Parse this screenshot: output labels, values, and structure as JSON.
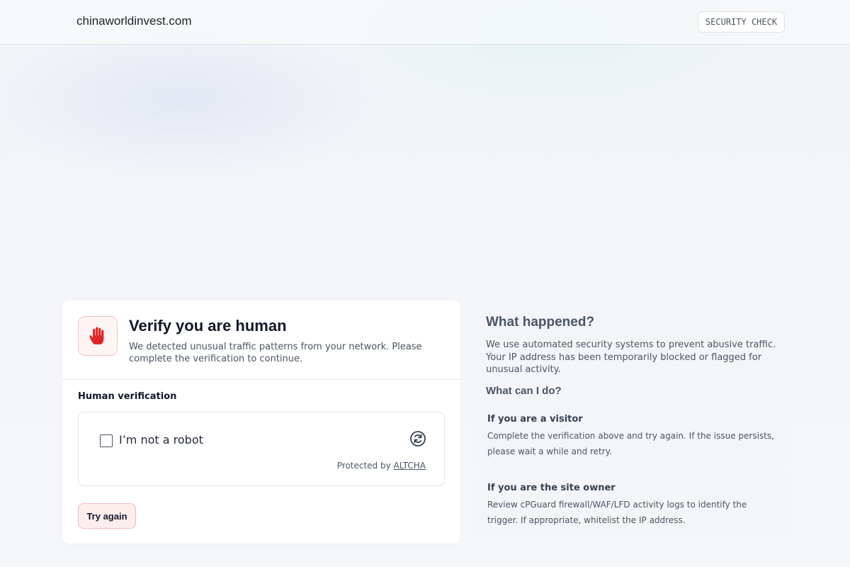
{
  "header": {
    "domain": "chinaworldinvest.com",
    "badge": "SECURITY CHECK"
  },
  "card": {
    "icon": "stop-hand-icon",
    "title": "Verify you are human",
    "subtitle": "We detected unusual traffic patterns from your network. Please complete the verification to continue.",
    "section_label": "Human verification",
    "widget": {
      "checkbox_label": "I’m not a robot",
      "checked": false,
      "refresh_icon": "refresh-icon",
      "protected_prefix": "Protected by",
      "protected_link": "ALTCHA"
    },
    "try_again_label": "Try again"
  },
  "info": {
    "heading": "What happened?",
    "description": "We use automated security systems to prevent abusive traffic. Your IP address has been temporarily blocked or flagged for unusual activity.",
    "subheading": "What can I do?",
    "panels": [
      {
        "title": "If you are a visitor",
        "text": "Complete the verification above and try again. If the issue persists, please wait a while and retry."
      },
      {
        "title": "If you are the site owner",
        "text": "Review cPGuard firewall/WAF/LFD activity logs to identify the trigger. If appropriate, whitelist the IP address."
      }
    ]
  },
  "colors": {
    "accent_red": "#e02424",
    "button_bg": "#fdeeee",
    "button_border": "#f0b8b8"
  }
}
